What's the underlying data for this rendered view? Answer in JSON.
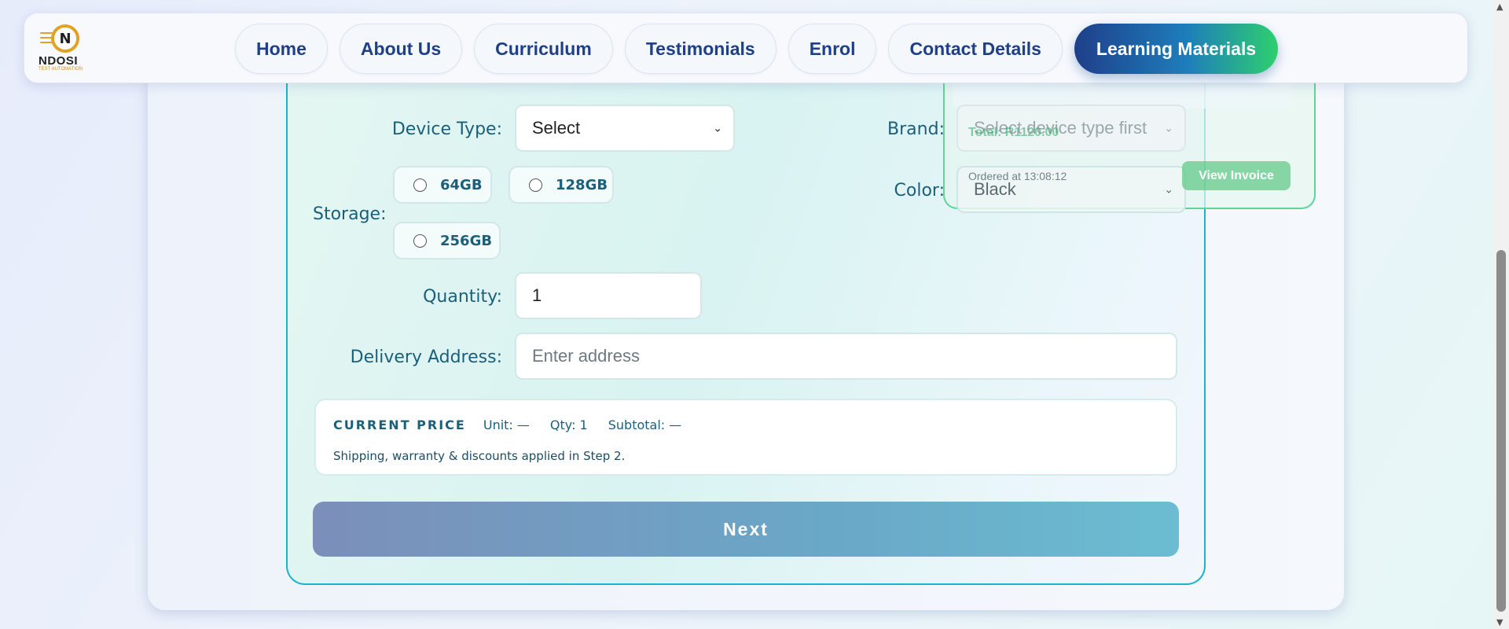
{
  "logo": {
    "initial": "N",
    "word": "NDOSI",
    "tagline": "TEST AUTOMATION"
  },
  "nav": {
    "items": [
      "Home",
      "About Us",
      "Curriculum",
      "Testimonials",
      "Enrol",
      "Contact Details",
      "Learning Materials"
    ],
    "active": "Learning Materials"
  },
  "form": {
    "device_type": {
      "label": "Device Type:",
      "value": "Select"
    },
    "brand": {
      "label": "Brand:",
      "placeholder": "Select device type first"
    },
    "storage": {
      "label": "Storage:",
      "options": [
        "64GB",
        "128GB",
        "256GB"
      ]
    },
    "color": {
      "label": "Color:",
      "value": "Black"
    },
    "quantity": {
      "label": "Quantity:",
      "value": "1"
    },
    "address": {
      "label": "Delivery Address:",
      "placeholder": "Enter address"
    }
  },
  "price": {
    "title": "CURRENT PRICE",
    "unit": "Unit: —",
    "qty": "Qty: 1",
    "subtotal": "Subtotal: —",
    "note": "Shipping, warranty & discounts applied in Step 2."
  },
  "next_label": "Next",
  "order_popup": {
    "total": "Total: R1120.00",
    "ordered_at": "Ordered at 13:08:12",
    "invoice_label": "View Invoice"
  },
  "colors": {
    "accent_teal": "#1bb3c8",
    "nav_text": "#1f3f87",
    "success_green": "#2ecf6f"
  }
}
